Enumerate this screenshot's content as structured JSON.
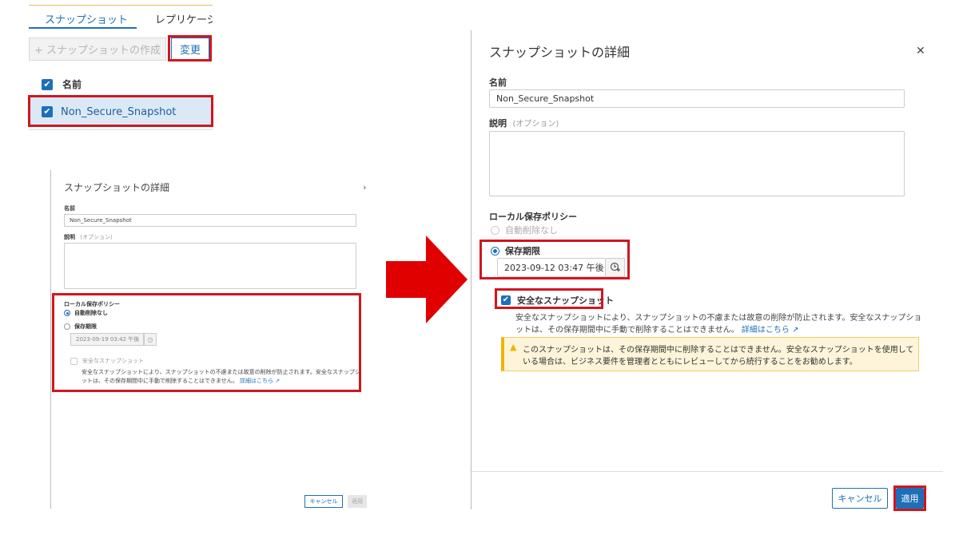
{
  "colors": {
    "accent": "#1e6fb8",
    "highlight_box": "#d0161f",
    "arrow": "#e00000",
    "warning_bg": "#fdf4d9",
    "warning_icon": "#f0b400"
  },
  "list_panel": {
    "tabs": [
      "スナップショット",
      "レプリケーシ"
    ],
    "create_button": "+ スナップショットの作成",
    "change_button": "変更",
    "column_header": "名前",
    "rows": [
      {
        "name": "Non_Secure_Snapshot",
        "checked": true
      }
    ]
  },
  "small_dialog": {
    "title": "スナップショットの詳細",
    "name_label": "名前",
    "name_value": "Non_Secure_Snapshot",
    "desc_label": "説明",
    "desc_hint": "(オプション)",
    "policy_label": "ローカル保存ポリシー",
    "opt_no_delete": "自動削除なし",
    "opt_retention": "保存期限",
    "retention_value": "2023-09-19 03:42 午後",
    "secure_label": "安全なスナップショット",
    "secure_desc_1": "安全なスナップショットにより、スナップショットの不慮または故意の削除が防止されます。安全なスナップシ",
    "secure_desc_2": "ットは、その保存期間中に手動で削除することはできません。",
    "more_link": "詳細はこちら",
    "cancel": "キャンセル",
    "apply": "適用"
  },
  "big_dialog": {
    "title": "スナップショットの詳細",
    "name_label": "名前",
    "name_value": "Non_Secure_Snapshot",
    "desc_label": "説明",
    "desc_hint": "(オプション)",
    "policy_label": "ローカル保存ポリシー",
    "opt_no_delete": "自動削除なし",
    "opt_retention": "保存期限",
    "retention_value": "2023-09-12 03:47 午後",
    "secure_label": "安全なスナップショット",
    "secure_checked": true,
    "secure_desc_1": "安全なスナップショットにより、スナップショットの不慮または故意の削除が防止されます。安全なスナップショ",
    "secure_desc_2": "ットは、その保存期間中に手動で削除することはできません。",
    "more_link": "詳細はこちら",
    "warning_1": "このスナップショットは、その保存期間中に削除することはできません。安全なスナップショットを使用して",
    "warning_2": "いる場合は、ビジネス要件を管理者とともにレビューしてから続行することをお勧めします。",
    "cancel": "キャンセル",
    "apply": "適用"
  },
  "icons": [
    "close-icon",
    "clock-icon",
    "external-link-icon",
    "warning-icon",
    "checkbox-check-icon",
    "right-arrow"
  ]
}
